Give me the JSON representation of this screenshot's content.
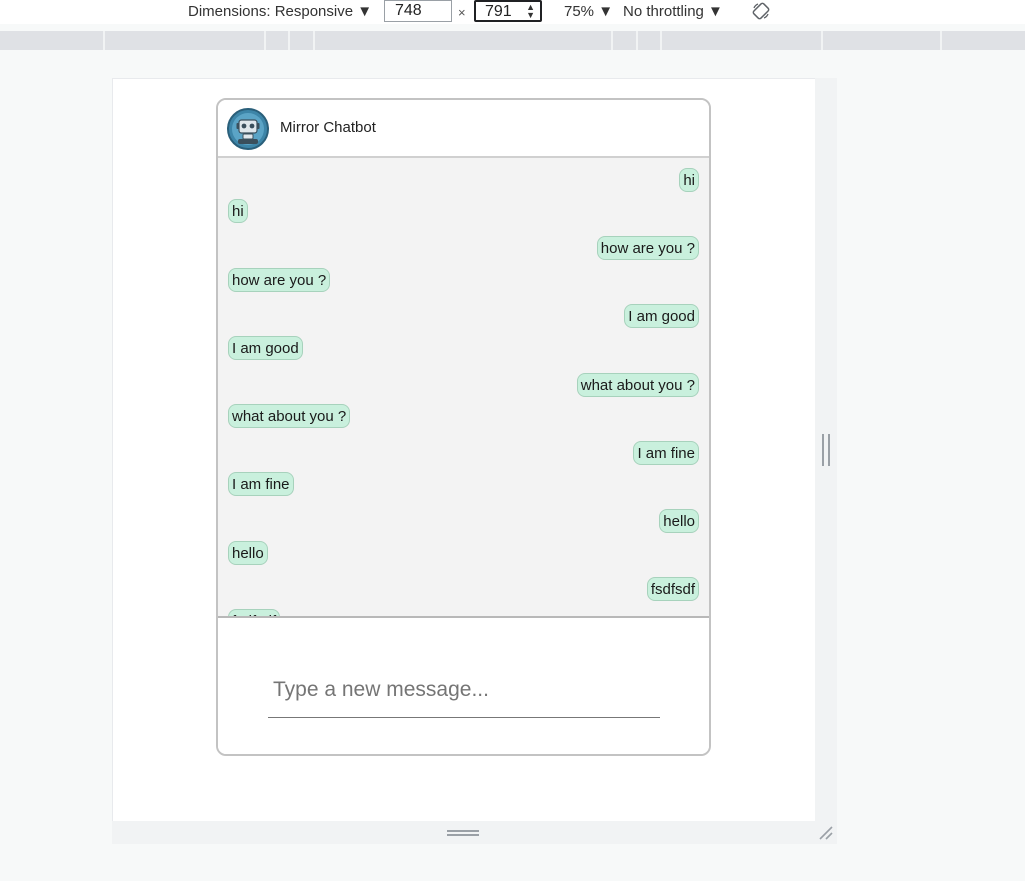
{
  "devtools": {
    "dimensions_label": "Dimensions: Responsive ▼",
    "width_value": "748",
    "times": "×",
    "height_value": "791",
    "zoom_label": "75% ▼",
    "throttling_label": "No throttling ▼",
    "rotate_icon": "rotate-icon"
  },
  "chat": {
    "title": "Mirror Chatbot",
    "avatar_icon": "robot-icon",
    "messages": [
      {
        "side": "sent",
        "text": "hi"
      },
      {
        "side": "recv",
        "text": "hi"
      },
      {
        "side": "sent",
        "text": "how are you ?"
      },
      {
        "side": "recv",
        "text": "how are you ?"
      },
      {
        "side": "sent",
        "text": "I am good"
      },
      {
        "side": "recv",
        "text": "I am good"
      },
      {
        "side": "sent",
        "text": "what about you ?"
      },
      {
        "side": "recv",
        "text": "what about you ?"
      },
      {
        "side": "sent",
        "text": "I am fine"
      },
      {
        "side": "recv",
        "text": "I am fine"
      },
      {
        "side": "sent",
        "text": "hello"
      },
      {
        "side": "recv",
        "text": "hello"
      },
      {
        "side": "sent",
        "text": "fsdfsdf"
      },
      {
        "side": "recv",
        "text": "fsdfsdf"
      }
    ],
    "input_placeholder": "Type a new message...",
    "input_value": ""
  },
  "colors": {
    "bubble": "#c9f0dd",
    "bubble_border": "#a7d2bc",
    "messages_bg": "#f3f3f3"
  }
}
